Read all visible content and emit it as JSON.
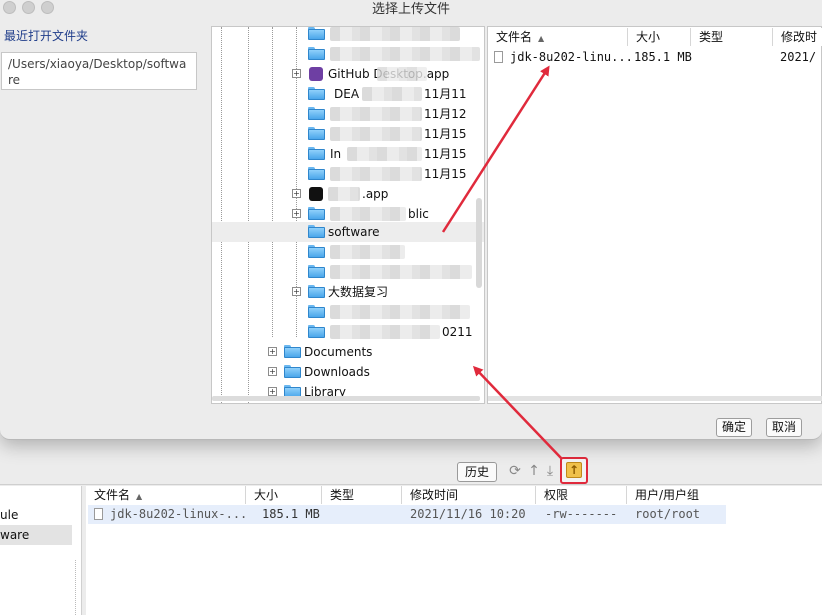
{
  "dialog": {
    "title": "选择上传文件",
    "recent_label": "最近打开文件夹",
    "path_value": "/Users/xiaoya/Desktop/software",
    "ok_label": "确定",
    "cancel_label": "取消"
  },
  "tree": {
    "visible_labels": [
      {
        "key": "github",
        "text": "GitHub Desktop.app"
      },
      {
        "key": "software",
        "text": "software"
      },
      {
        "key": "bigdata",
        "text": "大数据复习"
      },
      {
        "key": "documents",
        "text": "Documents"
      },
      {
        "key": "downloads",
        "text": "Downloads"
      },
      {
        "key": "library",
        "text": "Library"
      }
    ],
    "partial_texts": {
      "t1": "11月11",
      "t2": "11月12",
      "t3": "11月15",
      "t4": "11月15",
      "t5": "11月15",
      "t6": ".app",
      "t7": "blic",
      "t8": "0211",
      "t9": "DEA",
      "t10": "In"
    }
  },
  "file_list": {
    "columns": [
      "文件名",
      "大小",
      "类型",
      "修改时"
    ],
    "rows": [
      {
        "name": "jdk-8u202-linu...",
        "size": "185.1 MB",
        "type": "",
        "modified": "2021/"
      }
    ]
  },
  "background_app": {
    "history_label": "历史",
    "left_items": [
      "ule",
      "ware"
    ],
    "columns": [
      "文件名",
      "大小",
      "类型",
      "修改时间",
      "权限",
      "用户/用户组"
    ],
    "rows": [
      {
        "name": "jdk-8u202-linux-...",
        "size": "185.1 MB",
        "type": "",
        "modified": "2021/11/16 10:20",
        "perm": "-rw-------",
        "owner": "root/root"
      }
    ]
  },
  "icons": {
    "upload": "upload-icon",
    "refresh": "refresh-icon",
    "arrow_up": "arrow-up-icon",
    "download": "download-icon"
  },
  "colors": {
    "annotation_red": "#e02a3c",
    "folder_blue": "#4aa6ea",
    "link_blue": "#1f3d8a"
  }
}
